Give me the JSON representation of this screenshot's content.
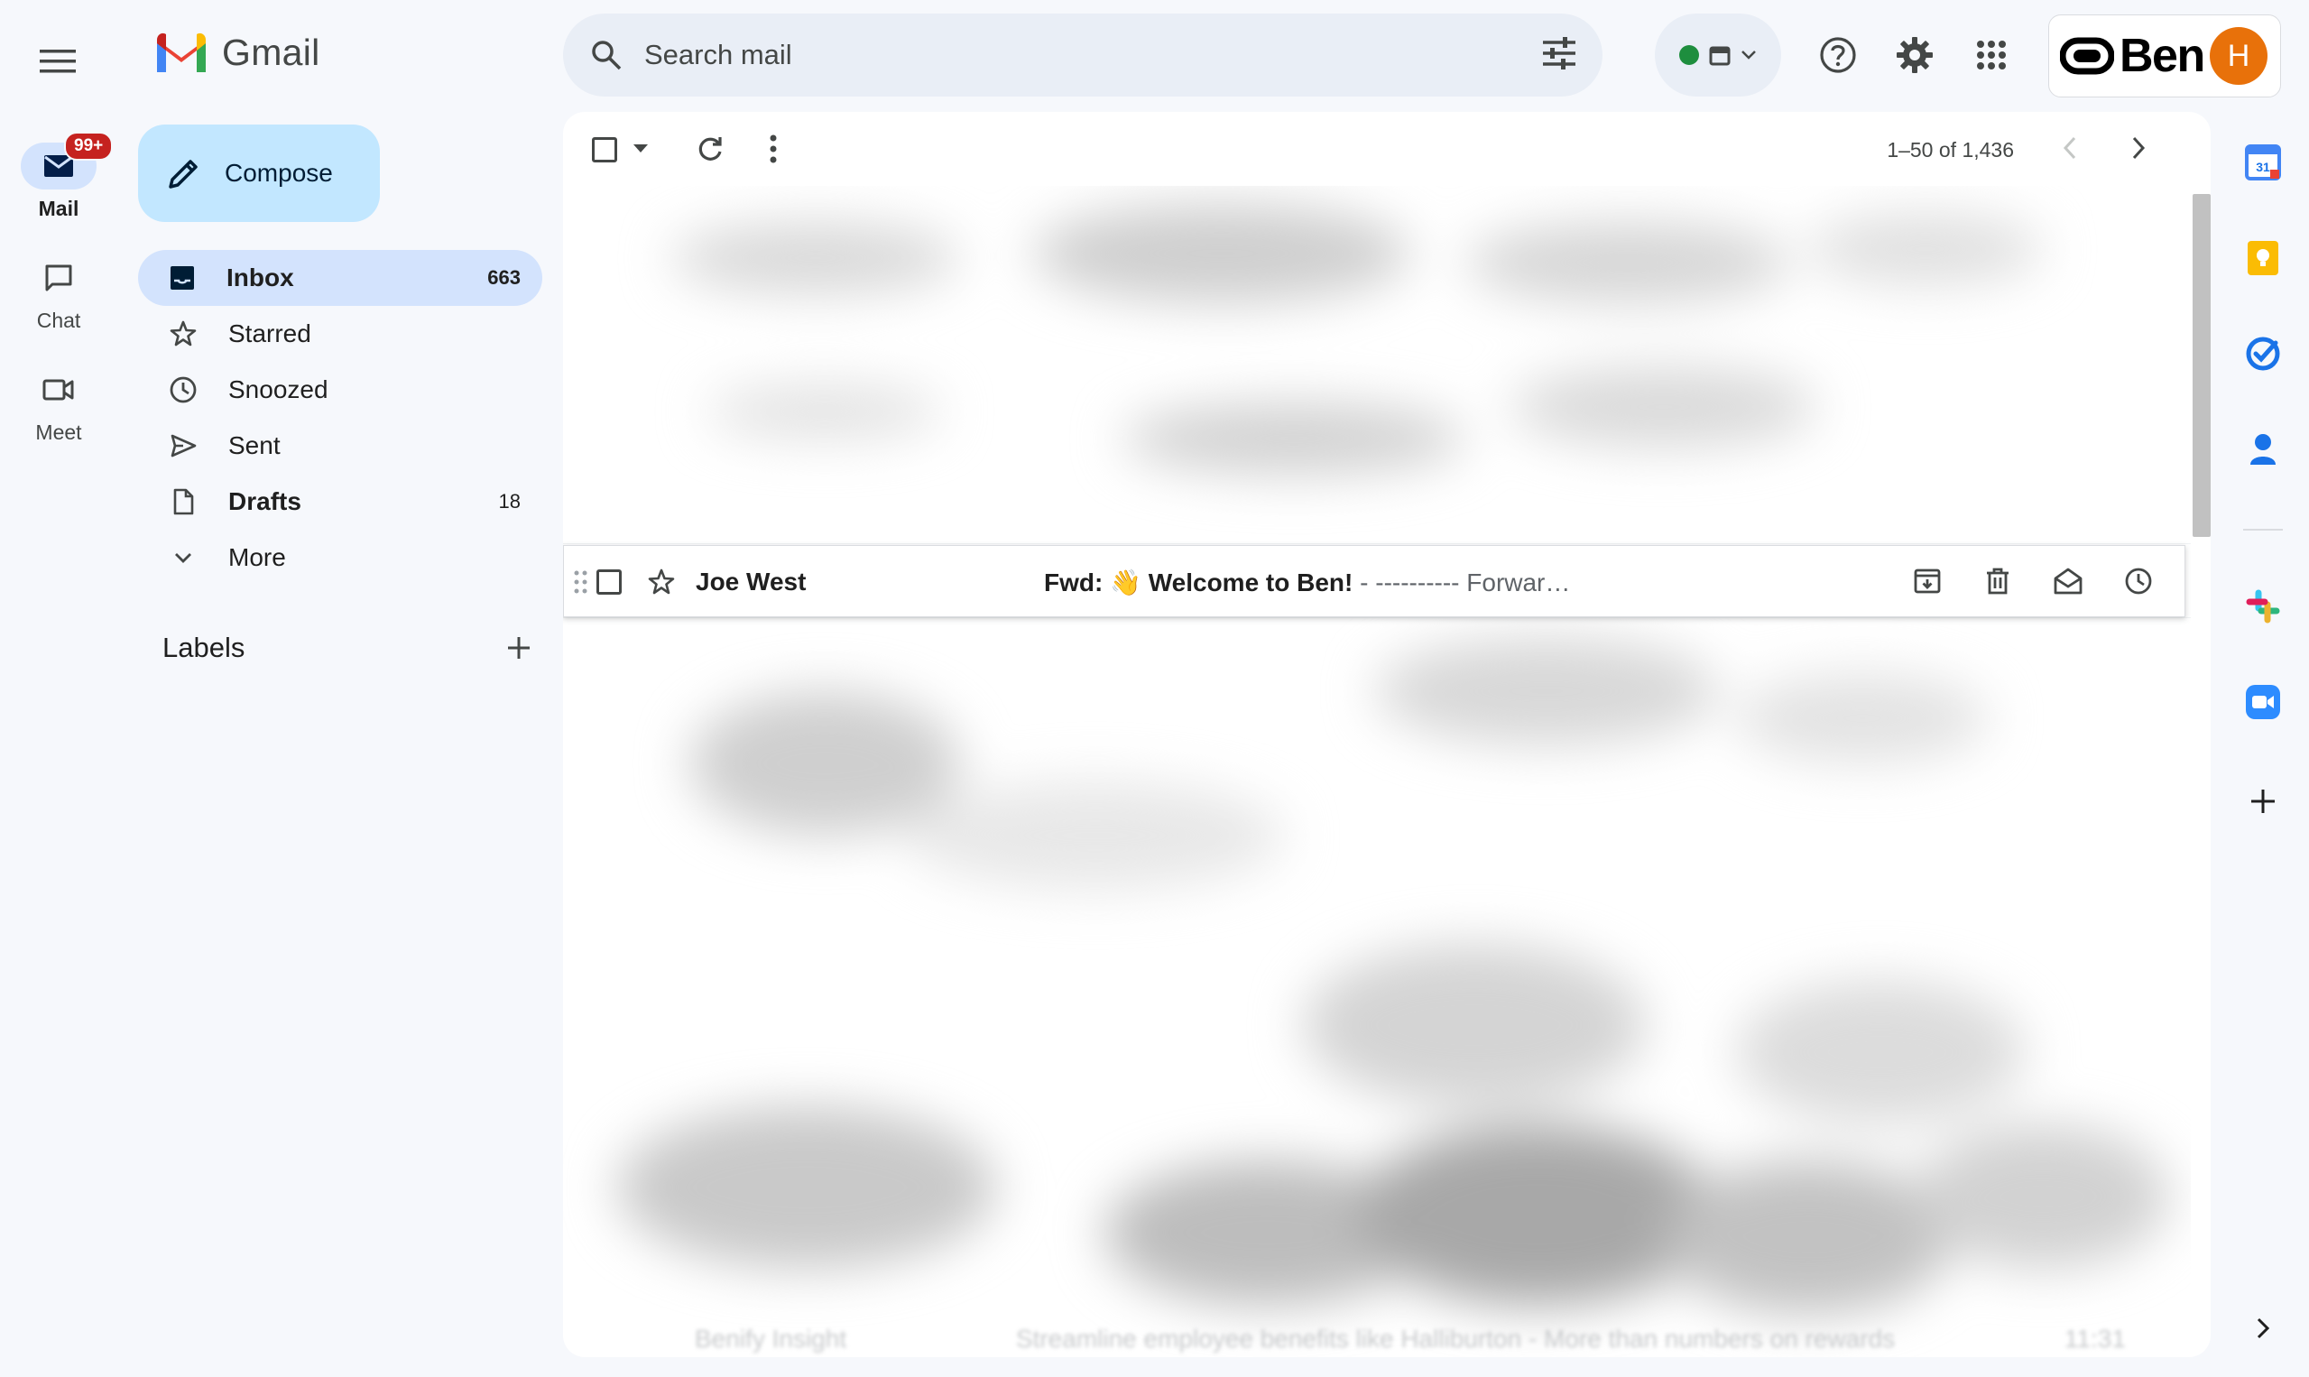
{
  "app": {
    "name": "Gmail"
  },
  "rail": {
    "items": [
      {
        "label": "Mail",
        "badge": "99+",
        "icon": "mail-icon"
      },
      {
        "label": "Chat",
        "icon": "chat-icon"
      },
      {
        "label": "Meet",
        "icon": "video-icon"
      }
    ]
  },
  "search": {
    "placeholder": "Search mail"
  },
  "account": {
    "brand": "Ben",
    "avatar_initial": "H"
  },
  "compose": {
    "label": "Compose"
  },
  "nav": {
    "items": [
      {
        "label": "Inbox",
        "count": "663",
        "icon": "inbox-icon"
      },
      {
        "label": "Starred",
        "count": "",
        "icon": "star-icon"
      },
      {
        "label": "Snoozed",
        "count": "",
        "icon": "clock-icon"
      },
      {
        "label": "Sent",
        "count": "",
        "icon": "send-icon"
      },
      {
        "label": "Drafts",
        "count": "18",
        "icon": "file-icon"
      },
      {
        "label": "More",
        "count": "",
        "icon": "chevron-down-icon"
      }
    ]
  },
  "labels": {
    "title": "Labels"
  },
  "toolbar": {
    "pager": "1–50 of 1,436"
  },
  "email": {
    "sender": "Joe West",
    "subject": "Fwd: 👋 Welcome to Ben!",
    "snippet": " - ---------- Forwarded message --------- Fro..."
  },
  "ghost": {
    "sender": "Benify Insight",
    "subject": "Streamline employee benefits like Halliburton - More than numbers on rewards",
    "time": "11:31"
  },
  "colors": {
    "accent": "#0b57d0",
    "active_nav": "#d3e3fd",
    "compose": "#c2e7ff",
    "badge": "#c5221f",
    "avatar": "#e8710a"
  }
}
